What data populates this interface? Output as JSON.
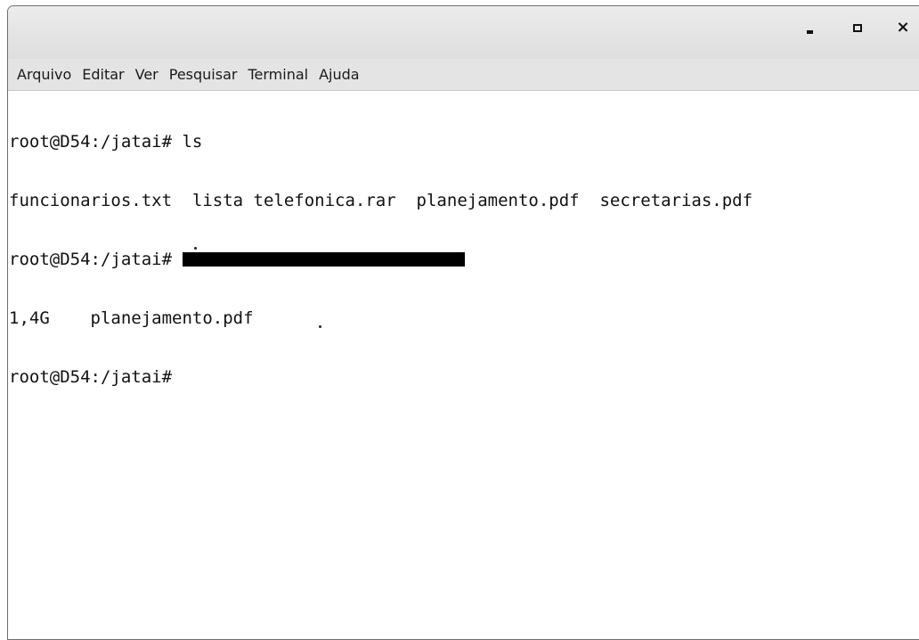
{
  "window": {
    "controls": {
      "minimize_icon": "minimize-icon",
      "maximize_icon": "maximize-icon",
      "close_symbol": "×"
    }
  },
  "menu": {
    "items": [
      "Arquivo",
      "Editar",
      "Ver",
      "Pesquisar",
      "Terminal",
      "Ajuda"
    ]
  },
  "terminal": {
    "lines": [
      {
        "prompt": "root@D54:/jatai#",
        "command": " ls",
        "redacted": false
      },
      {
        "output": "funcionarios.txt  lista telefonica.rar  planejamento.pdf  secretarias.pdf"
      },
      {
        "prompt": "root@D54:/jatai#",
        "command": "",
        "redacted": true
      },
      {
        "output": "1,4G    planejamento.pdf"
      },
      {
        "prompt": "root@D54:/jatai#",
        "command": "",
        "redacted": false
      }
    ]
  },
  "colors": {
    "titlebar": "#e6e6e6",
    "menubar": "#e4e4e4",
    "terminal_bg": "#ffffff",
    "terminal_fg": "#111111"
  }
}
